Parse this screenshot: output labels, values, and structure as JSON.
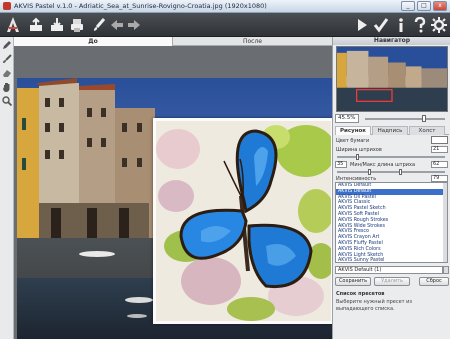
{
  "window": {
    "title": "AKVIS Pastel v.1.0 - Adriatic_Sea_at_Sunrise-Rovigno-Croatia.jpg (1920x1080)",
    "minimize": "_",
    "maximize": "□",
    "close": "x"
  },
  "toolbar": {
    "left_icons": [
      "open-icon",
      "save-icon",
      "print-icon",
      "brush-icon",
      "undo-icon",
      "redo-icon"
    ],
    "right_icons": [
      "run-icon",
      "apply-icon",
      "info-icon",
      "help-icon",
      "settings-icon"
    ]
  },
  "tools": [
    "pencil-icon",
    "brush-icon",
    "eraser-icon",
    "hand-icon",
    "zoom-icon"
  ],
  "view_tabs": {
    "before": "До",
    "after": "После"
  },
  "navigator": {
    "title": "Навигатор",
    "zoom_value": "45.5%",
    "zoom_level": 0.75
  },
  "panel_tabs": [
    "Рисунок",
    "Надпись",
    "Холст"
  ],
  "settings": {
    "paper_color_label": "Цвет бумаги",
    "stroke_width_label": "Ширина штрихов",
    "stroke_width_value": "21",
    "stroke_length_label": "Мин/Макс длина штриха",
    "stroke_length_min": "35",
    "stroke_length_max": "62",
    "intensity_label": "Интенсивность",
    "intensity_value": "79"
  },
  "presets": {
    "items": [
      "AKVIS Default",
      "AKVIS Default",
      "AKVIS Oil Pastel",
      "AKVIS Classic",
      "AKVIS Pastel Sketch",
      "AKVIS Soft Pastel",
      "AKVIS Rough Strokes",
      "AKVIS Wide Strokes",
      "AKVIS Fresco",
      "AKVIS Crayon Art",
      "AKVIS Fluffy Pastel",
      "AKVIS Rich Colors",
      "AKVIS Light Sketch",
      "AKVIS Sunny Pastel"
    ],
    "selected_index": 1,
    "current": "AKVIS Default (1)"
  },
  "buttons": {
    "save": "Сохранить",
    "delete": "Удалить",
    "reset": "Сброс"
  },
  "hint": {
    "title": "Список пресетов",
    "text": "Выберите нужный пресет из выпадающего списка."
  }
}
